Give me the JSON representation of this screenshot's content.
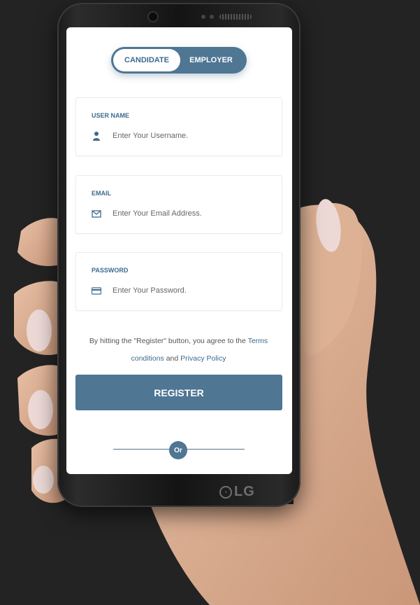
{
  "toggle": {
    "candidate": "CANDIDATE",
    "employer": "EMPLOYER",
    "active": "candidate"
  },
  "fields": {
    "username": {
      "label": "USER NAME",
      "placeholder": "Enter Your Username.",
      "icon": "user-icon"
    },
    "email": {
      "label": "EMAIL",
      "placeholder": "Enter Your Email Address.",
      "icon": "envelope-icon"
    },
    "password": {
      "label": "PASSWORD",
      "placeholder": "Enter Your Password.",
      "icon": "card-icon"
    }
  },
  "terms": {
    "prefix": "By hitting the \"Register\" button, you agree to the ",
    "terms_link": "Terms conditions",
    "and": " and ",
    "privacy_link": "Privacy Policy"
  },
  "register_label": "REGISTER",
  "or_label": "Or",
  "device_brand": "LG",
  "colors": {
    "accent": "#4f7693",
    "label": "#3d6a8c",
    "background": "#232323"
  }
}
